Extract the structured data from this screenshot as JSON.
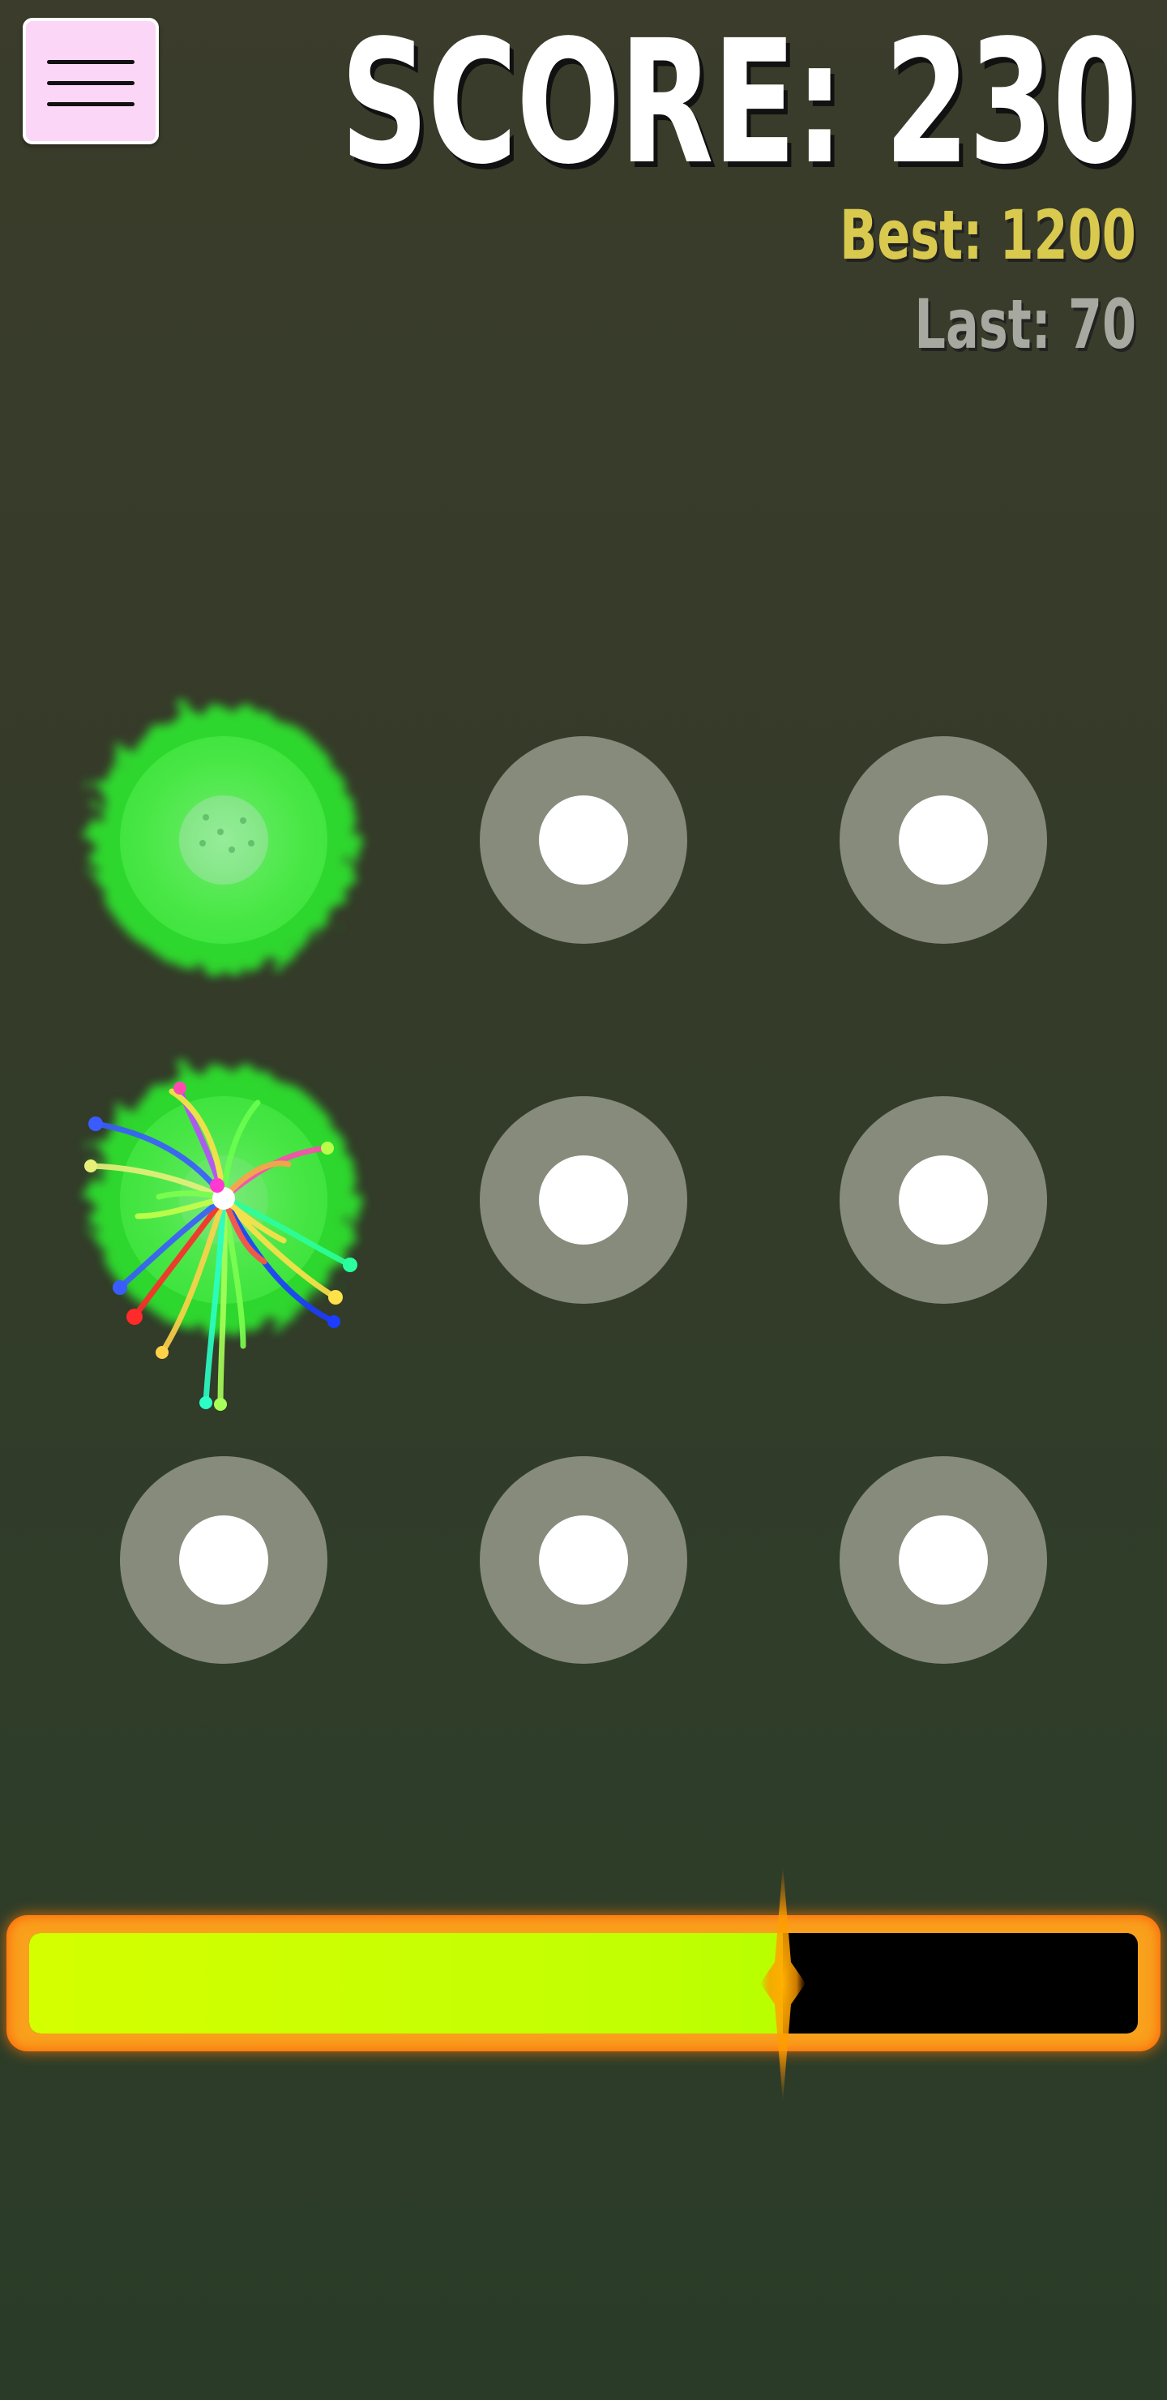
{
  "header": {
    "menu_icon": "hamburger-menu-icon",
    "score_text": "SCORE: 230",
    "best_text": "Best: 1200",
    "last_text": "Last: 70"
  },
  "grid": {
    "targets": [
      {
        "row": 1,
        "col": 1,
        "state": "hit-glow"
      },
      {
        "row": 1,
        "col": 2,
        "state": "idle"
      },
      {
        "row": 1,
        "col": 3,
        "state": "idle"
      },
      {
        "row": 2,
        "col": 1,
        "state": "hit-firework"
      },
      {
        "row": 2,
        "col": 2,
        "state": "idle"
      },
      {
        "row": 2,
        "col": 3,
        "state": "idle"
      },
      {
        "row": 3,
        "col": 1,
        "state": "idle"
      },
      {
        "row": 3,
        "col": 2,
        "state": "idle"
      },
      {
        "row": 3,
        "col": 3,
        "state": "idle"
      }
    ]
  },
  "timer": {
    "fill_fraction": 0.68
  },
  "colors": {
    "background": "#353b29",
    "target_ring": "#878b7c",
    "target_dot": "#ffffff",
    "hit_glow": "#3ee83e",
    "best": "#d9c94e",
    "last": "#a7a9a0",
    "timer_fill": "#c8ff00",
    "timer_border": "#f9a01c"
  }
}
